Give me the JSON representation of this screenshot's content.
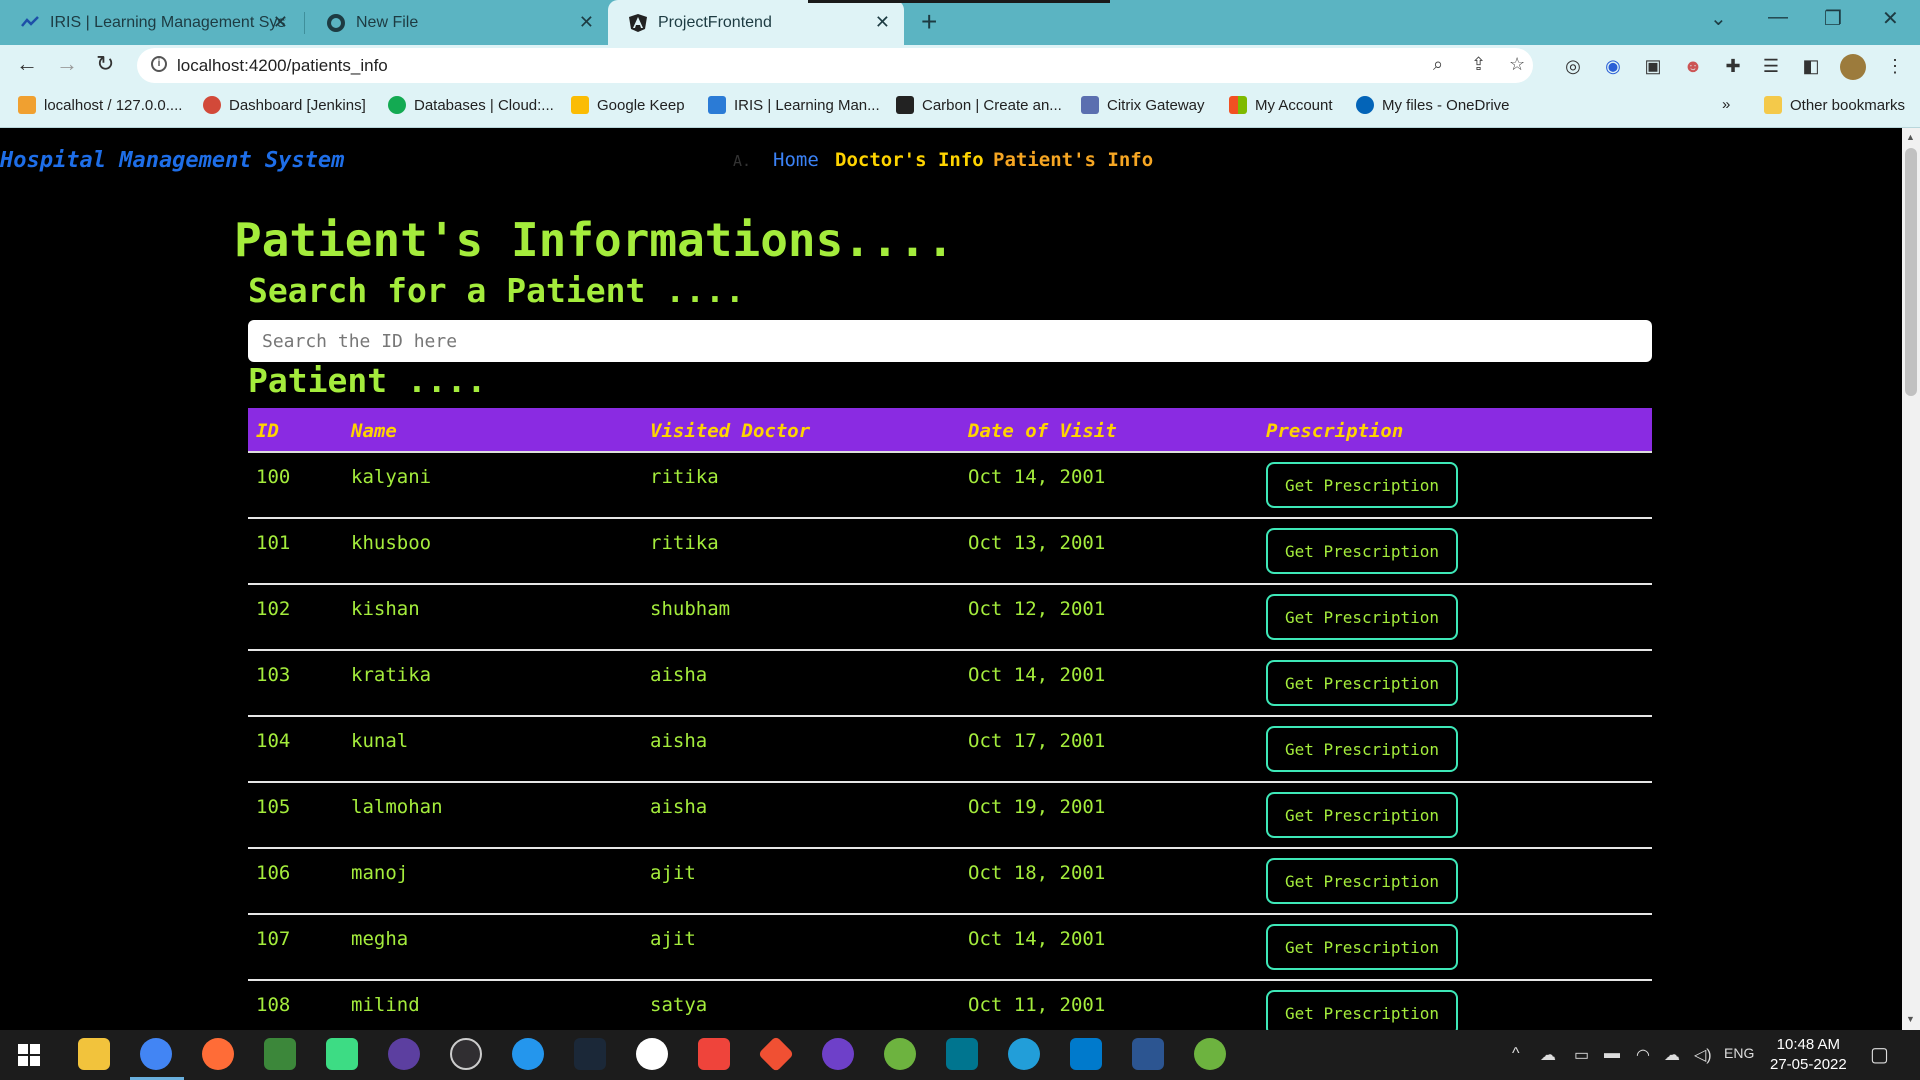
{
  "browser": {
    "tabs": [
      {
        "title": "IRIS | Learning Management Syst",
        "icon": "iris-icon"
      },
      {
        "title": "New File",
        "icon": "github-icon"
      },
      {
        "title": "ProjectFrontend",
        "icon": "angular-icon"
      }
    ],
    "url": "localhost:4200/patients_info",
    "bookmarks": [
      {
        "label": "localhost / 127.0.0....",
        "icon": "phpmyadmin-icon",
        "color": "#f0a030"
      },
      {
        "label": "Dashboard [Jenkins]",
        "icon": "jenkins-icon",
        "color": "#d24939"
      },
      {
        "label": "Databases | Cloud:...",
        "icon": "mongodb-icon",
        "color": "#13aa52"
      },
      {
        "label": "Google Keep",
        "icon": "keep-icon",
        "color": "#fbbc04"
      },
      {
        "label": "IRIS | Learning Man...",
        "icon": "iris-icon",
        "color": "#2b7bd6"
      },
      {
        "label": "Carbon | Create an...",
        "icon": "carbon-icon",
        "color": "#222222"
      },
      {
        "label": "Citrix Gateway",
        "icon": "citrix-icon",
        "color": "#5b6fb0"
      },
      {
        "label": "My Account",
        "icon": "microsoft-icon",
        "color": "#f25022"
      },
      {
        "label": "My files - OneDrive",
        "icon": "onedrive-icon",
        "color": "#0364b8"
      }
    ],
    "other_bookmarks": "Other bookmarks"
  },
  "nav": {
    "brand": "Hospital Management System",
    "a": "A.",
    "home": "Home",
    "doctors": "Doctor's Info",
    "patients": "Patient's Info"
  },
  "main": {
    "heading": "Patient's Informations....",
    "search_heading": "Search for a Patient ....",
    "search_placeholder": "Search the ID here",
    "patient_heading": "Patient ....",
    "columns": [
      "ID",
      "Name",
      "Visited Doctor",
      "Date of Visit",
      "Prescription"
    ],
    "button_label": "Get Prescription",
    "rows": [
      {
        "id": "100",
        "name": "kalyani",
        "doctor": "ritika",
        "date": "Oct 14, 2001"
      },
      {
        "id": "101",
        "name": "khusboo",
        "doctor": "ritika",
        "date": "Oct 13, 2001"
      },
      {
        "id": "102",
        "name": "kishan",
        "doctor": "shubham",
        "date": "Oct 12, 2001"
      },
      {
        "id": "103",
        "name": "kratika",
        "doctor": "aisha",
        "date": "Oct 14, 2001"
      },
      {
        "id": "104",
        "name": "kunal",
        "doctor": "aisha",
        "date": "Oct 17, 2001"
      },
      {
        "id": "105",
        "name": "lalmohan",
        "doctor": "aisha",
        "date": "Oct 19, 2001"
      },
      {
        "id": "106",
        "name": "manoj",
        "doctor": "ajit",
        "date": "Oct 18, 2001"
      },
      {
        "id": "107",
        "name": "megha",
        "doctor": "ajit",
        "date": "Oct 14, 2001"
      },
      {
        "id": "108",
        "name": "milind",
        "doctor": "satya",
        "date": "Oct 11, 2001"
      }
    ]
  },
  "taskbar": {
    "apps": [
      "windows-start-icon",
      "file-explorer-icon",
      "chrome-icon",
      "postman-icon",
      "nodejs-icon",
      "android-studio-icon",
      "eclipse-icon",
      "obs-icon",
      "docker-icon",
      "steam-icon",
      "mongodb-compass-icon",
      "anydesk-icon",
      "git-icon",
      "github-desktop-icon",
      "spring-tools-icon",
      "mysql-workbench-icon",
      "telegram-icon",
      "vscode-icon",
      "powershell-icon",
      "spring-tools-icon"
    ],
    "lang": "ENG",
    "time": "10:48 AM",
    "date": "27-05-2022"
  },
  "colors": {
    "accent_green": "#a4ec3c",
    "header_purple": "#8a2be2",
    "header_text_yellow": "#ffd400",
    "button_border": "#3ee8b8",
    "brand_blue": "#1e6ee8"
  }
}
